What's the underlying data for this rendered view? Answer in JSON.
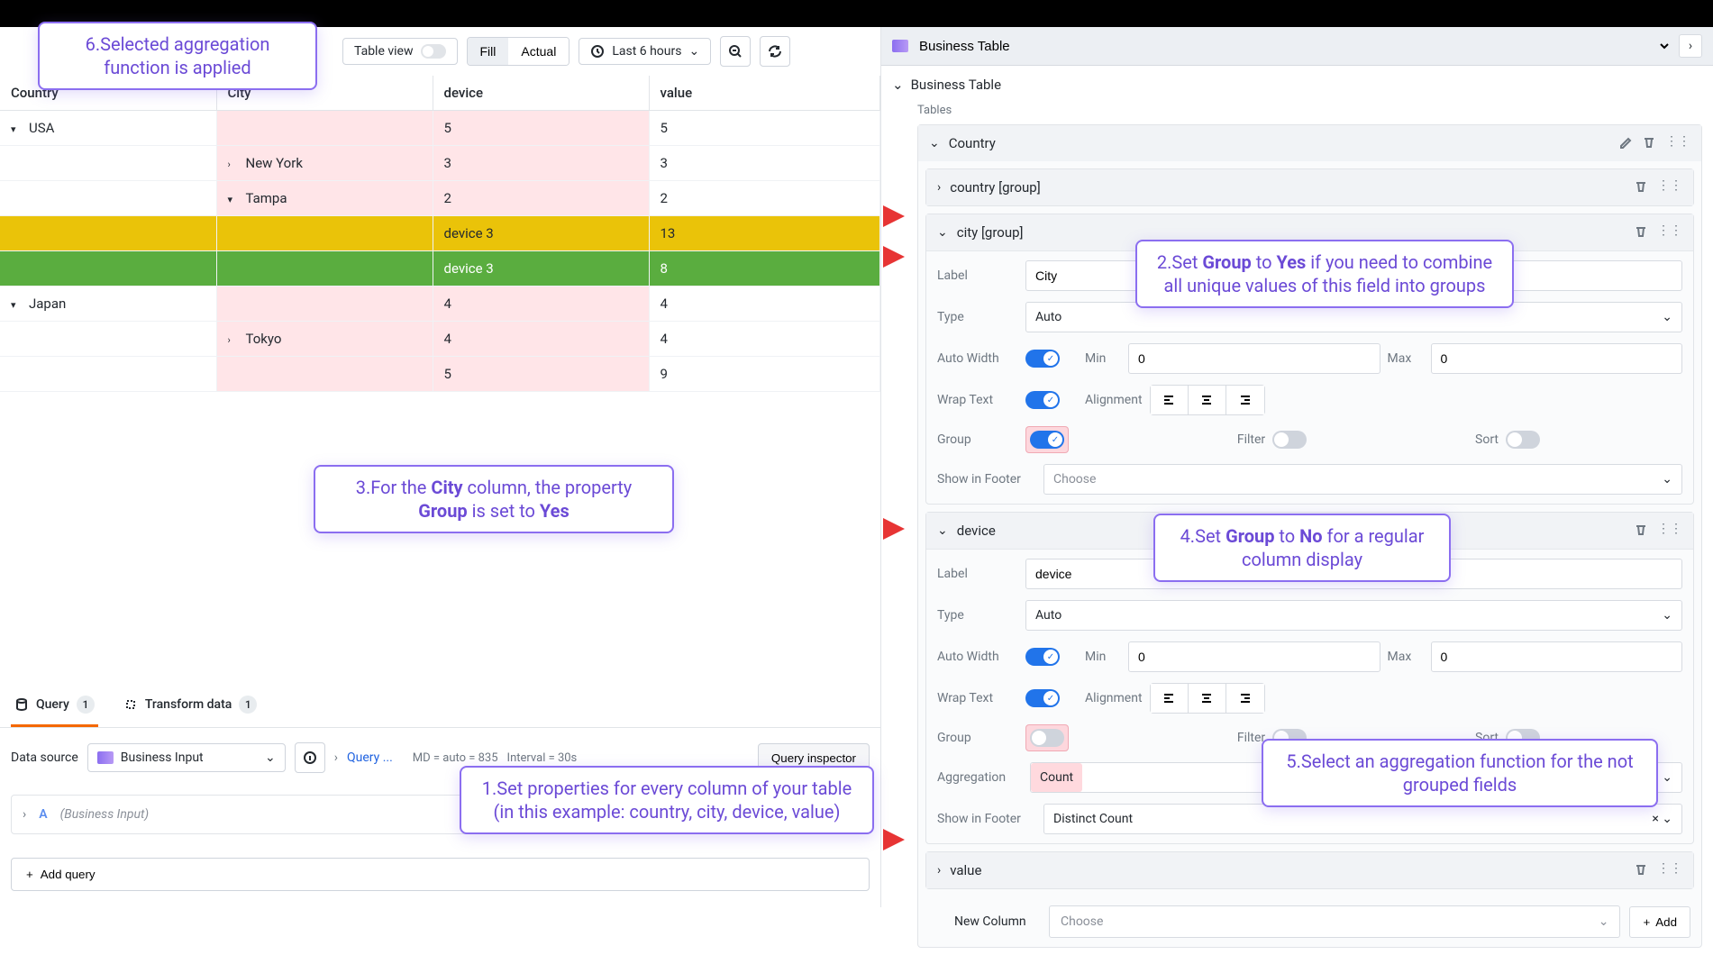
{
  "toolbar": {
    "view_label": "Table view",
    "fill": "Fill",
    "actual": "Actual",
    "time_range": "Last 6 hours"
  },
  "table": {
    "headers": {
      "c1": "Country",
      "c2": "City",
      "c3": "device",
      "c4": "value"
    },
    "rows": [
      {
        "c1": "USA",
        "c2": "",
        "c3": "5",
        "c4": "5",
        "caret1": "▾",
        "class": ""
      },
      {
        "c1": "",
        "c2": "New York",
        "c3": "3",
        "c4": "3",
        "caret2": "›",
        "class": ""
      },
      {
        "c1": "",
        "c2": "Tampa",
        "c3": "2",
        "c4": "2",
        "caret2": "▾",
        "class": ""
      },
      {
        "c1": "",
        "c2": "",
        "c3": "device 3",
        "c4": "13",
        "class": "yellow"
      },
      {
        "c1": "",
        "c2": "",
        "c3": "device 3",
        "c4": "8",
        "class": "green"
      },
      {
        "c1": "Japan",
        "c2": "",
        "c3": "4",
        "c4": "4",
        "caret1": "▾",
        "class": ""
      },
      {
        "c1": "",
        "c2": "Tokyo",
        "c3": "4",
        "c4": "4",
        "caret2": "›",
        "class": ""
      },
      {
        "c1": "",
        "c2": "",
        "c3": "5",
        "c4": "9",
        "class": ""
      }
    ]
  },
  "tabs": {
    "query": "Query",
    "query_count": "1",
    "transform": "Transform data",
    "transform_count": "1"
  },
  "datasource": {
    "label": "Data source",
    "value": "Business Input",
    "query_options": "Query ...",
    "md": "MD = auto = 835",
    "interval": "Interval = 30s",
    "inspector": "Query inspector"
  },
  "query_a": {
    "id": "A",
    "name": "(Business Input)"
  },
  "add_query": "Add query",
  "panel": {
    "title": "Business Table",
    "section": "Business Table",
    "tables_label": "Tables",
    "country_header": "Country",
    "country_group": "country [group]",
    "city_group": "city [group]",
    "device": "device",
    "value": "value",
    "new_column": "New Column",
    "choose": "Choose",
    "add": "Add"
  },
  "city": {
    "label_k": "Label",
    "label_v": "City",
    "type_k": "Type",
    "type_v": "Auto",
    "aw": "Auto Width",
    "min": "Min",
    "min_v": "0",
    "max": "Max",
    "max_v": "0",
    "wrap": "Wrap Text",
    "align": "Alignment",
    "group": "Group",
    "filter": "Filter",
    "sort": "Sort",
    "footer": "Show in Footer",
    "footer_v": "Choose"
  },
  "dev": {
    "label_k": "Label",
    "label_v": "device",
    "type_k": "Type",
    "type_v": "Auto",
    "aw": "Auto Width",
    "min": "Min",
    "min_v": "0",
    "max": "Max",
    "max_v": "0",
    "wrap": "Wrap Text",
    "align": "Alignment",
    "group": "Group",
    "filter": "Filter",
    "sort": "Sort",
    "agg": "Aggregation",
    "agg_v": "Count",
    "footer": "Show in Footer",
    "footer_v": "Distinct Count"
  },
  "annotations": {
    "a1": "1.Set properties for every column of your table (in this example: country, city, device, value)",
    "a2_pre": "2.Set ",
    "a2_g": "Group",
    "a2_mid": " to ",
    "a2_y": "Yes",
    "a2_post": " if you need to combine all unique values of this field into groups",
    "a3_pre": "3.For the ",
    "a3_c": "City",
    "a3_mid": " column, the property ",
    "a3_g": "Group",
    "a3_mid2": " is set to ",
    "a3_y": "Yes",
    "a4_pre": "4.Set ",
    "a4_g": "Group",
    "a4_mid": " to ",
    "a4_n": "No",
    "a4_post": " for a regular column display",
    "a5": "5.Select an aggregation function for the not grouped fields",
    "a6": "6.Selected aggregation function is applied"
  }
}
